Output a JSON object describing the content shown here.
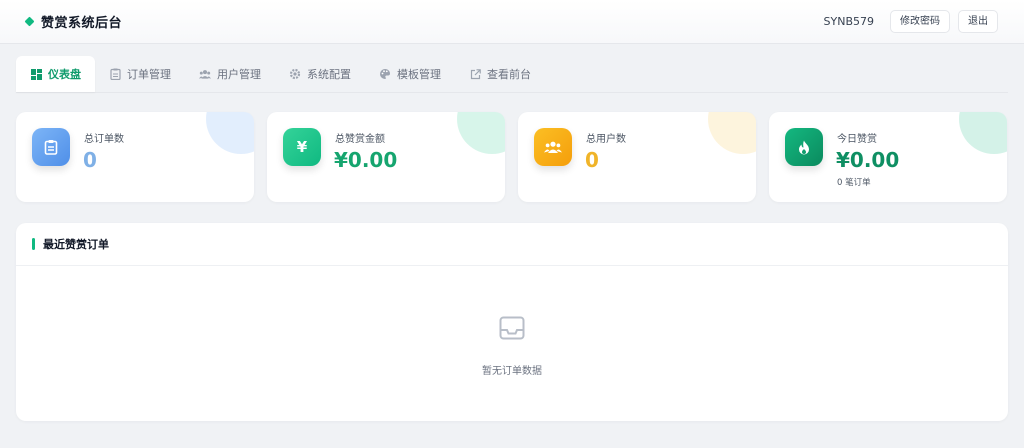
{
  "header": {
    "title": "赞赏系统后台",
    "username": "SYNB579",
    "change_password": "修改密码",
    "logout": "退出"
  },
  "tabs": [
    {
      "label": "仪表盘",
      "icon": "dashboard-icon",
      "active": true
    },
    {
      "label": "订单管理",
      "icon": "clipboard-icon",
      "active": false
    },
    {
      "label": "用户管理",
      "icon": "users-icon",
      "active": false
    },
    {
      "label": "系统配置",
      "icon": "gear-icon",
      "active": false
    },
    {
      "label": "模板管理",
      "icon": "palette-icon",
      "active": false
    },
    {
      "label": "查看前台",
      "icon": "external-link-icon",
      "active": false
    }
  ],
  "stats": [
    {
      "label": "总订单数",
      "value": "0",
      "icon": "clipboard-icon",
      "color": "#5fa0f2",
      "value_color": "#7fb0e6"
    },
    {
      "label": "总赞赏金额",
      "value": "¥0.00",
      "icon": "yen-icon",
      "color": "#22c58a",
      "value_color": "#16a56f"
    },
    {
      "label": "总用户数",
      "value": "0",
      "icon": "users-icon",
      "color": "#f5a524",
      "value_color": "#f0b429"
    },
    {
      "label": "今日赞赏",
      "value": "¥0.00",
      "sub": "0 笔订单",
      "icon": "fire-icon",
      "color": "#0f9f6e",
      "value_color": "#0f8f63"
    }
  ],
  "recent_orders": {
    "title": "最近赞赏订单",
    "empty_text": "暂无订单数据"
  },
  "colors": {
    "accent": "#10b981",
    "background": "#f0f2f5"
  }
}
